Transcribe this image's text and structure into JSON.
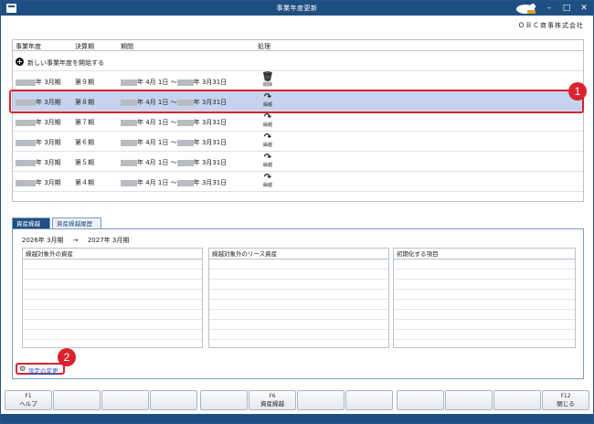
{
  "window": {
    "title": "事業年度更新"
  },
  "company": "ＯＢＣ商事株式会社",
  "table": {
    "headers": [
      "事業年度",
      "決算期",
      "期間",
      "処理"
    ],
    "new_year_label": "新しい事業年度を開始する",
    "rows": [
      {
        "year_suffix": "年 3月期",
        "period_no": "第９期",
        "from": "年 4月 1日 〜",
        "to": "年 3月31日",
        "action_label": "削除",
        "action_icon": "trash-icon"
      },
      {
        "year_suffix": "年 3月期",
        "period_no": "第８期",
        "from": "年 4月 1日 〜",
        "to": "年 3月31日",
        "action_label": "繰越",
        "action_icon": "carry-forward-icon"
      },
      {
        "year_suffix": "年 3月期",
        "period_no": "第７期",
        "from": "年 4月 1日 〜",
        "to": "年 3月31日",
        "action_label": "繰越",
        "action_icon": "carry-forward-icon"
      },
      {
        "year_suffix": "年 3月期",
        "period_no": "第６期",
        "from": "年 4月 1日 〜",
        "to": "年 3月31日",
        "action_label": "繰越",
        "action_icon": "carry-forward-icon"
      },
      {
        "year_suffix": "年 3月期",
        "period_no": "第５期",
        "from": "年 4月 1日 〜",
        "to": "年 3月31日",
        "action_label": "繰越",
        "action_icon": "carry-forward-icon"
      },
      {
        "year_suffix": "年 3月期",
        "period_no": "第４期",
        "from": "年 4月 1日 〜",
        "to": "年 3月31日",
        "action_label": "繰越",
        "action_icon": "carry-forward-icon"
      }
    ],
    "selected_row_index": 1
  },
  "tabs": [
    {
      "label": "資産繰越",
      "active": true
    },
    {
      "label": "資産繰越履歴",
      "active": false
    }
  ],
  "detail": {
    "from_period": "2026年 3月期",
    "arrow": "→",
    "to_period": "2027年 3月期",
    "lists": [
      {
        "header": "繰越対象外の資産"
      },
      {
        "header": "繰越対象外のリース資産"
      },
      {
        "header": "初期化する項目"
      }
    ]
  },
  "settings_link": "設定の変更",
  "markers": [
    "1",
    "2"
  ],
  "fkeys": [
    {
      "key": "F1",
      "label": "ヘルプ"
    },
    {
      "key": "",
      "label": ""
    },
    {
      "key": "",
      "label": ""
    },
    {
      "key": "",
      "label": ""
    },
    {
      "key": "",
      "label": ""
    },
    {
      "key": "F6",
      "label": "資産繰越"
    },
    {
      "key": "",
      "label": ""
    },
    {
      "key": "",
      "label": ""
    },
    {
      "key": "",
      "label": ""
    },
    {
      "key": "",
      "label": ""
    },
    {
      "key": "",
      "label": ""
    },
    {
      "key": "F12",
      "label": "閉じる"
    }
  ],
  "colors": {
    "accent": "#1f4f82",
    "selection": "#c5d3ee",
    "highlight": "#d8242f",
    "link": "#2a55c9"
  }
}
